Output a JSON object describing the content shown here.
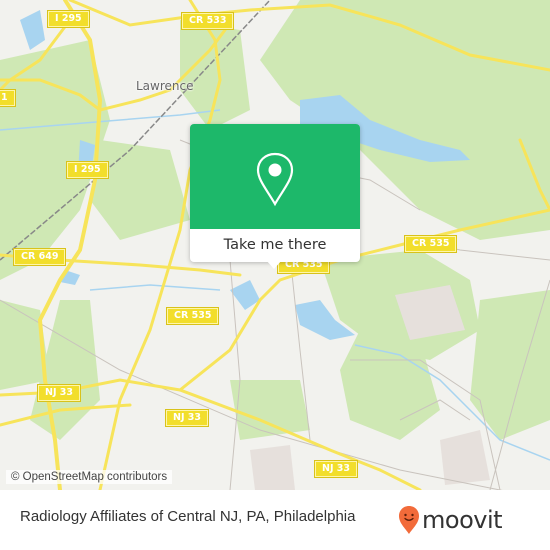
{
  "map": {
    "place_labels": [
      {
        "name": "town-lawrence",
        "text": "Lawrence"
      }
    ],
    "road_shields": [
      {
        "name": "shield-i295-top",
        "text": "I 295"
      },
      {
        "name": "shield-cr533",
        "text": "CR 533"
      },
      {
        "name": "shield-left-edge",
        "text": "1"
      },
      {
        "name": "shield-i295-mid",
        "text": "I 295"
      },
      {
        "name": "shield-cr649",
        "text": "CR 649"
      },
      {
        "name": "shield-cr535-right",
        "text": "CR 535"
      },
      {
        "name": "shield-cr535-center",
        "text": "CR 535"
      },
      {
        "name": "shield-cr535-left",
        "text": "CR 535"
      },
      {
        "name": "shield-nj33-left",
        "text": "NJ 33"
      },
      {
        "name": "shield-nj33-mid",
        "text": "NJ 33"
      },
      {
        "name": "shield-nj33-bottom",
        "text": "NJ 33"
      }
    ],
    "attribution": "© OpenStreetMap contributors",
    "colors": {
      "land": "#f2f2ee",
      "forest": "#c8e6a8",
      "water": "#a8d4f0",
      "road": "#f7e45a",
      "minor_road": "#c9c3bd"
    }
  },
  "popup": {
    "icon": "map-pin-icon",
    "button_label": "Take me there",
    "color": "#1db86a"
  },
  "footer": {
    "place_name": "Radiology Affiliates of Central NJ, PA, Philadelphia",
    "brand": "moovit",
    "brand_color": "#f26b3a"
  }
}
